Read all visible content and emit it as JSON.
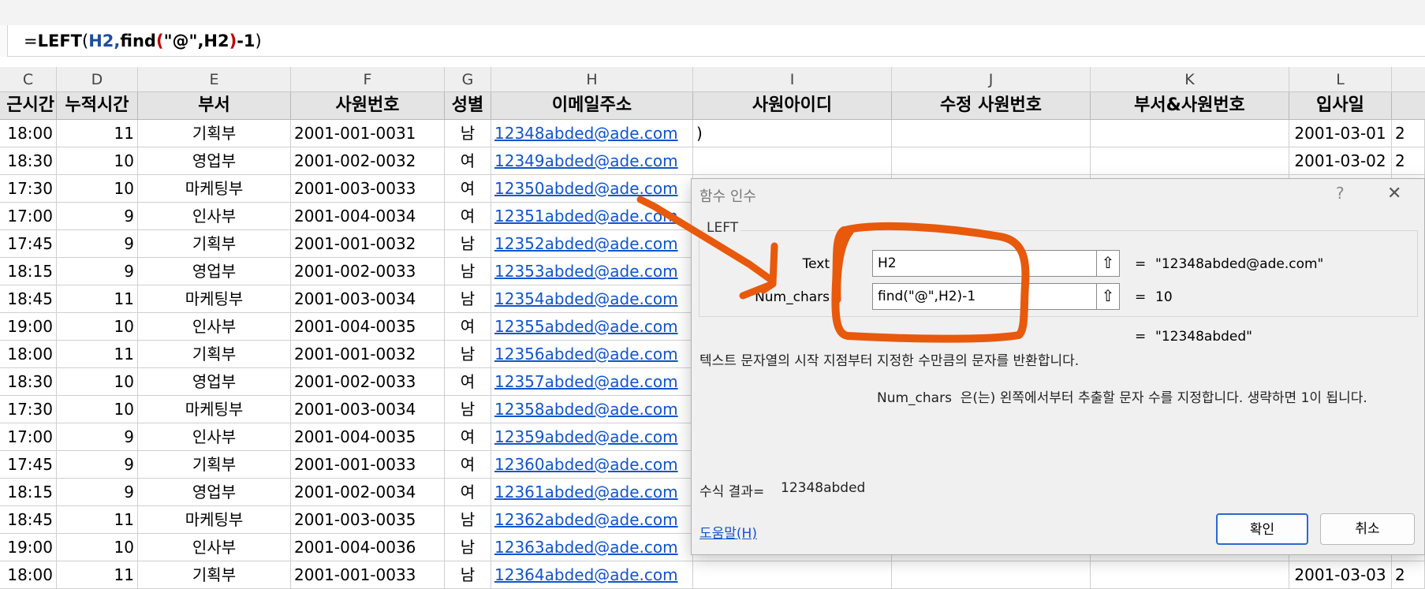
{
  "formula_bar": {
    "prefix": "=",
    "func": "LEFT",
    "open": "(",
    "arg1": "H2,",
    "inner": "find",
    "inner_open": "(",
    "inner_args": "\"@\",H2",
    "inner_close": ")",
    "tail": "-1",
    "close": ")"
  },
  "columns": [
    "C",
    "D",
    "E",
    "F",
    "G",
    "H",
    "I",
    "J",
    "K",
    "L"
  ],
  "header_row": [
    "근시간",
    "누적시간",
    "부서",
    "사원번호",
    "성별",
    "이메일주소",
    "사원아이디",
    "수정 사원번호",
    "부서&사원번호",
    "입사일"
  ],
  "rows": [
    {
      "time": "18:00",
      "total": "11",
      "dept": "기획부",
      "emp": "2001-001-0031",
      "sex": "남",
      "email": "12348abded@ade.com",
      "id": ")",
      "hire": "2001-03-01",
      "m": "2"
    },
    {
      "time": "18:30",
      "total": "10",
      "dept": "영업부",
      "emp": "2001-002-0032",
      "sex": "여",
      "email": "12349abded@ade.com",
      "id": "",
      "hire": "2001-03-02",
      "m": "2"
    },
    {
      "time": "17:30",
      "total": "10",
      "dept": "마케팅부",
      "emp": "2001-003-0033",
      "sex": "여",
      "email": "12350abded@ade.com",
      "id": "",
      "hire": "",
      "m": ""
    },
    {
      "time": "17:00",
      "total": "9",
      "dept": "인사부",
      "emp": "2001-004-0034",
      "sex": "여",
      "email": "12351abded@ade.com",
      "id": "",
      "hire": "",
      "m": ""
    },
    {
      "time": "17:45",
      "total": "9",
      "dept": "기획부",
      "emp": "2001-001-0032",
      "sex": "남",
      "email": "12352abded@ade.com",
      "id": "",
      "hire": "",
      "m": ""
    },
    {
      "time": "18:15",
      "total": "9",
      "dept": "영업부",
      "emp": "2001-002-0033",
      "sex": "남",
      "email": "12353abded@ade.com",
      "id": "",
      "hire": "",
      "m": ""
    },
    {
      "time": "18:45",
      "total": "11",
      "dept": "마케팅부",
      "emp": "2001-003-0034",
      "sex": "남",
      "email": "12354abded@ade.com",
      "id": "",
      "hire": "",
      "m": ""
    },
    {
      "time": "19:00",
      "total": "10",
      "dept": "인사부",
      "emp": "2001-004-0035",
      "sex": "여",
      "email": "12355abded@ade.com",
      "id": "",
      "hire": "",
      "m": ""
    },
    {
      "time": "18:00",
      "total": "11",
      "dept": "기획부",
      "emp": "2001-001-0032",
      "sex": "남",
      "email": "12356abded@ade.com",
      "id": "",
      "hire": "",
      "m": ""
    },
    {
      "time": "18:30",
      "total": "10",
      "dept": "영업부",
      "emp": "2001-002-0033",
      "sex": "여",
      "email": "12357abded@ade.com",
      "id": "",
      "hire": "",
      "m": ""
    },
    {
      "time": "17:30",
      "total": "10",
      "dept": "마케팅부",
      "emp": "2001-003-0034",
      "sex": "남",
      "email": "12358abded@ade.com",
      "id": "",
      "hire": "",
      "m": ""
    },
    {
      "time": "17:00",
      "total": "9",
      "dept": "인사부",
      "emp": "2001-004-0035",
      "sex": "여",
      "email": "12359abded@ade.com",
      "id": "",
      "hire": "",
      "m": ""
    },
    {
      "time": "17:45",
      "total": "9",
      "dept": "기획부",
      "emp": "2001-001-0033",
      "sex": "여",
      "email": "12360abded@ade.com",
      "id": "",
      "hire": "",
      "m": ""
    },
    {
      "time": "18:15",
      "total": "9",
      "dept": "영업부",
      "emp": "2001-002-0034",
      "sex": "여",
      "email": "12361abded@ade.com",
      "id": "",
      "hire": "",
      "m": ""
    },
    {
      "time": "18:45",
      "total": "11",
      "dept": "마케팅부",
      "emp": "2001-003-0035",
      "sex": "남",
      "email": "12362abded@ade.com",
      "id": "",
      "hire": "",
      "m": ""
    },
    {
      "time": "19:00",
      "total": "10",
      "dept": "인사부",
      "emp": "2001-004-0036",
      "sex": "남",
      "email": "12363abded@ade.com",
      "id": "",
      "hire": "",
      "m": ""
    },
    {
      "time": "18:00",
      "total": "11",
      "dept": "기획부",
      "emp": "2001-001-0033",
      "sex": "남",
      "email": "12364abded@ade.com",
      "id": "",
      "hire": "2001-03-03",
      "m": "2"
    }
  ],
  "dialog": {
    "title": "함수 인수",
    "help_icon": "?",
    "close_icon": "✕",
    "function_name": "LEFT",
    "args": [
      {
        "label": "Text",
        "value": "H2",
        "eq": "=",
        "result": "\"12348abded@ade.com\""
      },
      {
        "label": "Num_chars",
        "value": "find(\"@\",H2)-1",
        "eq": "=",
        "result": "10"
      }
    ],
    "overall_eq": "=",
    "overall_result": "\"12348abded\"",
    "description": "텍스트 문자열의 시작 지점부터 지정한 수만큼의 문자를 반환합니다.",
    "arg_desc_name": "Num_chars",
    "arg_desc_text": "은(는) 왼쪽에서부터 추출할 문자 수를 지정합니다. 생략하면 1이 됩니다.",
    "result_label": "수식 결과=",
    "result_value": "12348abded",
    "help_link": "도움말(H)",
    "ok_label": "확인",
    "cancel_label": "취소"
  },
  "colors": {
    "annotation": "#e8590c",
    "link": "#1155cc",
    "header_bg": "#e4e4e4"
  }
}
